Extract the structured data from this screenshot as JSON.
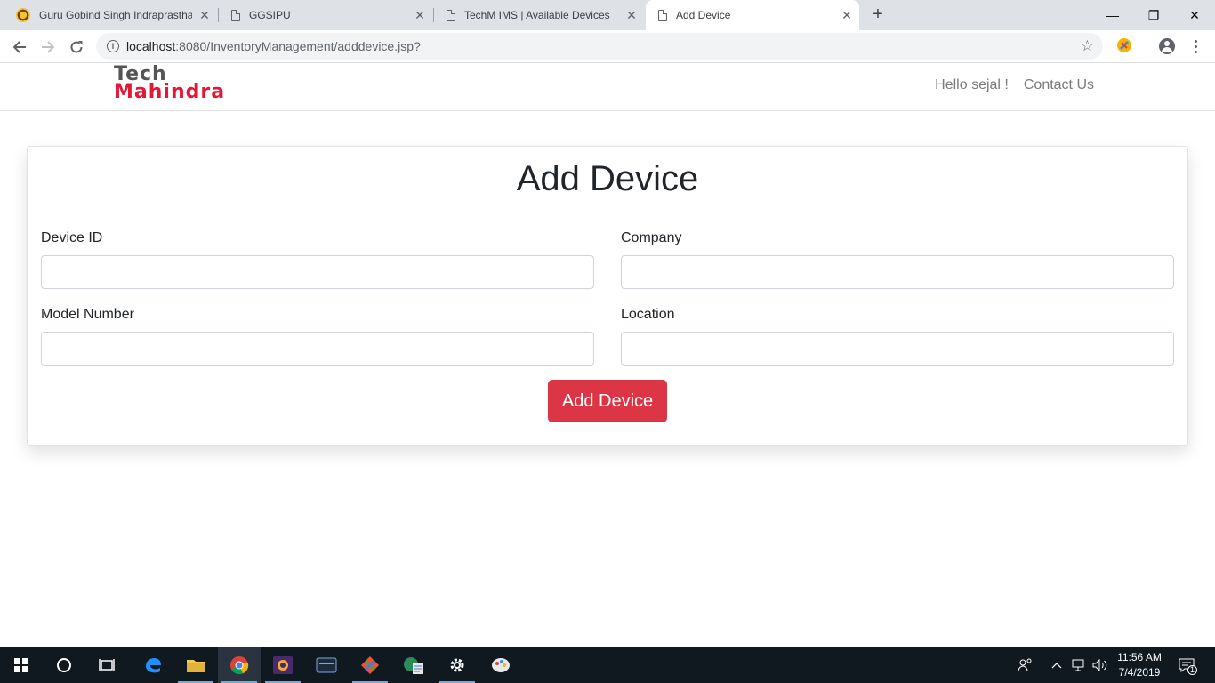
{
  "browser": {
    "tabs": [
      {
        "title": "Guru Gobind Singh Indraprastha",
        "icon": "university-seal-icon",
        "active": false
      },
      {
        "title": "GGSIPU",
        "icon": "page-icon",
        "active": false
      },
      {
        "title": "TechM IMS | Available Devices",
        "icon": "page-icon",
        "active": false
      },
      {
        "title": "Add Device",
        "icon": "page-icon",
        "active": true
      }
    ],
    "close_glyph": "✕",
    "new_tab_glyph": "+",
    "url_host": "localhost",
    "url_rest": ":8080/InventoryManagement/adddevice.jsp?",
    "window_controls": {
      "minimize": "—",
      "maximize": "❐",
      "close": "✕"
    }
  },
  "site": {
    "logo_line1": "Tech",
    "logo_line2": "Mahindra",
    "greeting": "Hello sejal !",
    "contact": "Contact Us"
  },
  "form": {
    "title": "Add Device",
    "fields": {
      "device_id": {
        "label": "Device ID",
        "value": ""
      },
      "company": {
        "label": "Company",
        "value": ""
      },
      "model_number": {
        "label": "Model Number",
        "value": ""
      },
      "location": {
        "label": "Location",
        "value": ""
      }
    },
    "submit_label": "Add Device"
  },
  "taskbar": {
    "time": "11:56 AM",
    "date": "7/4/2019",
    "notification_count": "1"
  },
  "colors": {
    "brand_red": "#e31837",
    "button_red": "#dc3545",
    "taskbar_bg": "#101820"
  }
}
